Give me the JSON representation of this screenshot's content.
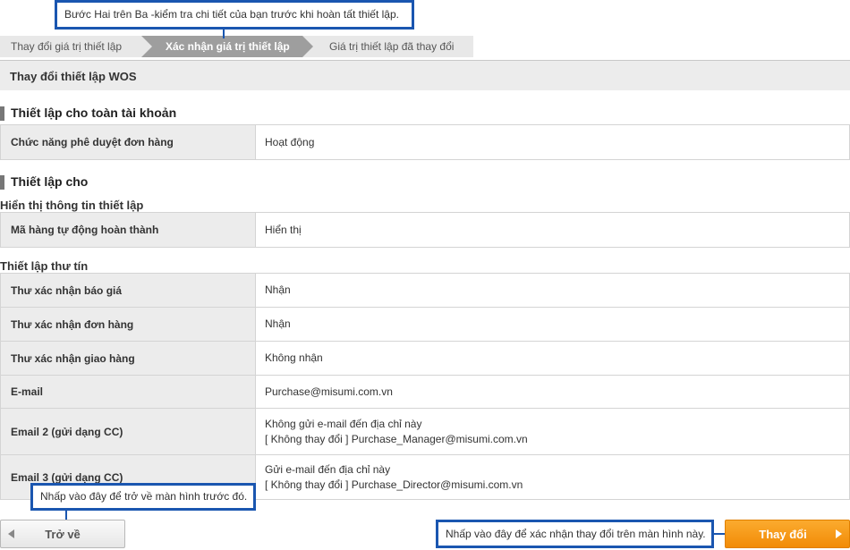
{
  "steps": {
    "step1": "Thay đổi giá trị thiết lập",
    "step2": "Xác nhận giá trị thiết lập",
    "step3": "Giá trị thiết lập đã thay đổi"
  },
  "callouts": {
    "top": "Bước Hai trên Ba -kiểm tra chi tiết của bạn trước khi hoàn tất thiết lập.",
    "back": "Nhấp vào đây để trở về màn hình trước đó.",
    "change": "Nhấp vào đây để xác nhận thay đổi trên màn hình này."
  },
  "header": {
    "title": "Thay đổi thiết lập WOS"
  },
  "account_section": {
    "title": "Thiết lập cho toàn tài khoản",
    "rows": [
      {
        "label": "Chức năng phê duyệt đơn hàng",
        "value": "Hoạt động"
      }
    ]
  },
  "settings_section": {
    "title": "Thiết lập cho",
    "display_subtitle": "Hiển thị thông tin thiết lập",
    "display_rows": [
      {
        "label": "Mã hàng tự động hoàn thành",
        "value": "Hiển thị"
      }
    ],
    "mail_subtitle": "Thiết lập thư tín",
    "mail_rows": [
      {
        "label": "Thư xác nhận báo giá",
        "value": "Nhận"
      },
      {
        "label": "Thư xác nhận đơn hàng",
        "value": "Nhận"
      },
      {
        "label": "Thư xác nhận giao hàng",
        "value": "Không nhận"
      },
      {
        "label": "E-mail",
        "value": "Purchase@misumi.com.vn"
      },
      {
        "label": "Email 2 (gửi dạng CC)",
        "value": "Không gửi e-mail đến địa chỉ này",
        "value2": "[ Không thay đổi ]   Purchase_Manager@misumi.com.vn"
      },
      {
        "label": "Email 3 (gửi dạng CC)",
        "value": "Gửi e-mail đến địa chỉ này",
        "value2": "[ Không thay đổi ]   Purchase_Director@misumi.com.vn"
      }
    ]
  },
  "buttons": {
    "back": "Trở về",
    "change": "Thay đổi"
  },
  "colors": {
    "callout_border": "#1a56b0",
    "primary_button": "#f28b06",
    "active_step": "#9e9e9e"
  }
}
